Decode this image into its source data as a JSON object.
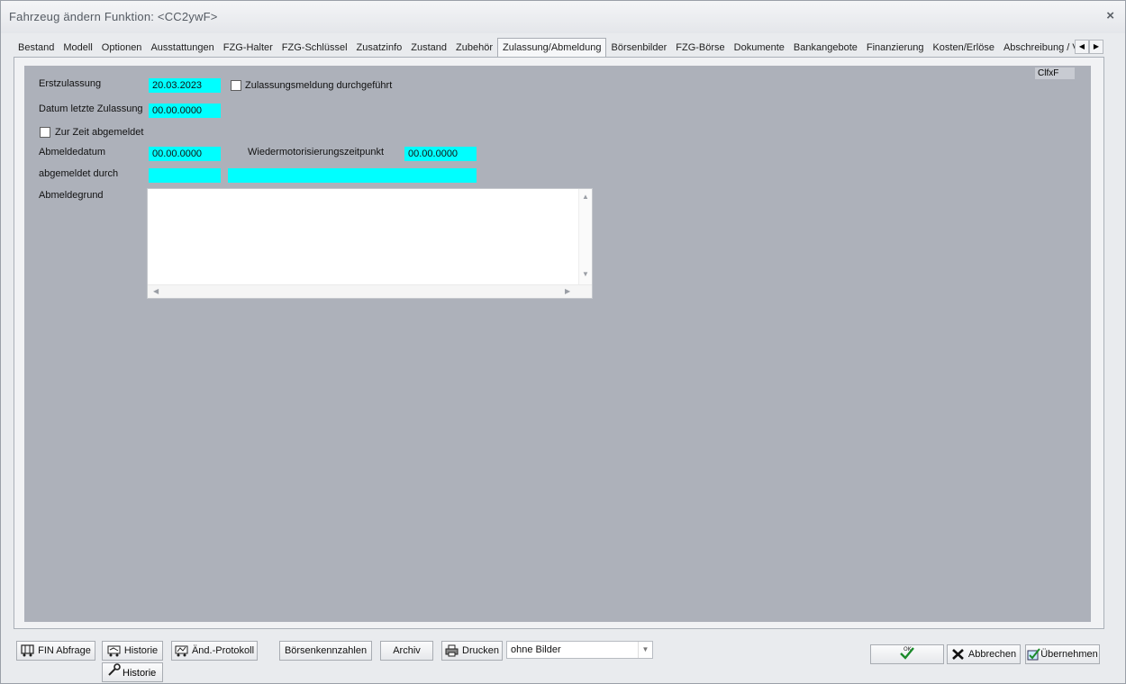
{
  "window": {
    "title": "Fahrzeug ändern   Funktion: <CC2ywF>",
    "close_glyph": "×"
  },
  "tabs": [
    {
      "label": "Bestand"
    },
    {
      "label": "Modell"
    },
    {
      "label": "Optionen"
    },
    {
      "label": "Ausstattungen"
    },
    {
      "label": "FZG-Halter"
    },
    {
      "label": "FZG-Schlüssel"
    },
    {
      "label": "Zusatzinfo"
    },
    {
      "label": "Zustand"
    },
    {
      "label": "Zubehör"
    },
    {
      "label": "Zulassung/Abmeldung",
      "active": true
    },
    {
      "label": "Börsenbilder"
    },
    {
      "label": "FZG-Börse"
    },
    {
      "label": "Dokumente"
    },
    {
      "label": "Bankangebote"
    },
    {
      "label": "Finanzierung"
    },
    {
      "label": "Kosten/Erlöse"
    },
    {
      "label": "Abschreibung / V"
    }
  ],
  "tab_scroll": {
    "left": "◀",
    "right": "▶"
  },
  "panel": {
    "badge": "ClfxF",
    "erstzulassung_label": "Erstzulassung",
    "erstzulassung_value": "20.03.2023",
    "zulassungsmeldung_label": "Zulassungsmeldung durchgeführt",
    "zulassungsmeldung_checked": false,
    "datum_letzte_label": "Datum letzte Zulassung",
    "datum_letzte_value": "00.00.0000",
    "zur_zeit_label": "Zur Zeit abgemeldet",
    "zur_zeit_checked": false,
    "abmeldedatum_label": "Abmeldedatum",
    "abmeldedatum_value": "00.00.0000",
    "wiedermot_label": "Wiedermotorisierungszeitpunkt",
    "wiedermot_value": "00.00.0000",
    "abgemeldet_durch_label": "abgemeldet durch",
    "abgemeldet_durch_code": "",
    "abgemeldet_durch_name": "",
    "abmeldegrund_label": "Abmeldegrund",
    "abmeldegrund_value": ""
  },
  "colors": {
    "field_bg": "#00ffff",
    "panel_bg": "#adb1ba"
  },
  "toolbar": {
    "fin_abfrage": "FIN Abfrage",
    "historie": "Historie",
    "aend_protokoll": "Änd.-Protokoll",
    "boersenkennzahlen": "Börsenkennzahlen",
    "archiv": "Archiv",
    "drucken": "Drucken",
    "bilder_option": "ohne Bilder",
    "historie_sub": "Historie",
    "ok": "OK",
    "abbrechen": "Abbrechen",
    "uebernehmen": "Übernehmen"
  }
}
